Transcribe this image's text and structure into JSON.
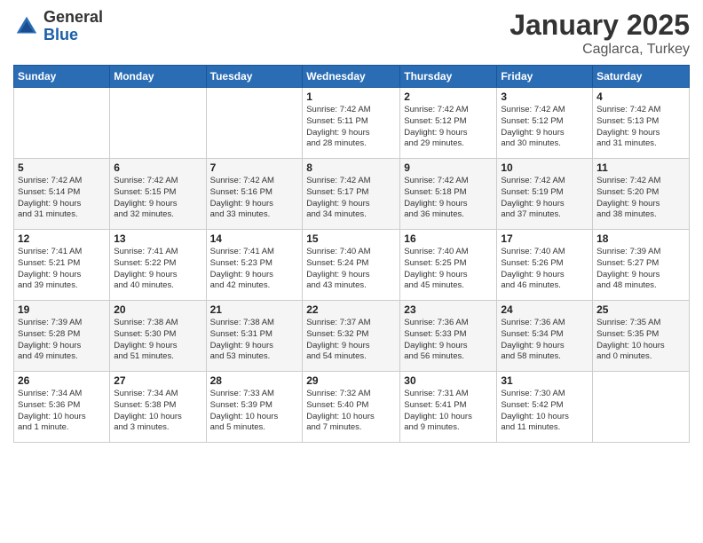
{
  "logo": {
    "general": "General",
    "blue": "Blue"
  },
  "header": {
    "month": "January 2025",
    "location": "Caglarca, Turkey"
  },
  "weekdays": [
    "Sunday",
    "Monday",
    "Tuesday",
    "Wednesday",
    "Thursday",
    "Friday",
    "Saturday"
  ],
  "weeks": [
    [
      {
        "day": "",
        "info": ""
      },
      {
        "day": "",
        "info": ""
      },
      {
        "day": "",
        "info": ""
      },
      {
        "day": "1",
        "info": "Sunrise: 7:42 AM\nSunset: 5:11 PM\nDaylight: 9 hours\nand 28 minutes."
      },
      {
        "day": "2",
        "info": "Sunrise: 7:42 AM\nSunset: 5:12 PM\nDaylight: 9 hours\nand 29 minutes."
      },
      {
        "day": "3",
        "info": "Sunrise: 7:42 AM\nSunset: 5:12 PM\nDaylight: 9 hours\nand 30 minutes."
      },
      {
        "day": "4",
        "info": "Sunrise: 7:42 AM\nSunset: 5:13 PM\nDaylight: 9 hours\nand 31 minutes."
      }
    ],
    [
      {
        "day": "5",
        "info": "Sunrise: 7:42 AM\nSunset: 5:14 PM\nDaylight: 9 hours\nand 31 minutes."
      },
      {
        "day": "6",
        "info": "Sunrise: 7:42 AM\nSunset: 5:15 PM\nDaylight: 9 hours\nand 32 minutes."
      },
      {
        "day": "7",
        "info": "Sunrise: 7:42 AM\nSunset: 5:16 PM\nDaylight: 9 hours\nand 33 minutes."
      },
      {
        "day": "8",
        "info": "Sunrise: 7:42 AM\nSunset: 5:17 PM\nDaylight: 9 hours\nand 34 minutes."
      },
      {
        "day": "9",
        "info": "Sunrise: 7:42 AM\nSunset: 5:18 PM\nDaylight: 9 hours\nand 36 minutes."
      },
      {
        "day": "10",
        "info": "Sunrise: 7:42 AM\nSunset: 5:19 PM\nDaylight: 9 hours\nand 37 minutes."
      },
      {
        "day": "11",
        "info": "Sunrise: 7:42 AM\nSunset: 5:20 PM\nDaylight: 9 hours\nand 38 minutes."
      }
    ],
    [
      {
        "day": "12",
        "info": "Sunrise: 7:41 AM\nSunset: 5:21 PM\nDaylight: 9 hours\nand 39 minutes."
      },
      {
        "day": "13",
        "info": "Sunrise: 7:41 AM\nSunset: 5:22 PM\nDaylight: 9 hours\nand 40 minutes."
      },
      {
        "day": "14",
        "info": "Sunrise: 7:41 AM\nSunset: 5:23 PM\nDaylight: 9 hours\nand 42 minutes."
      },
      {
        "day": "15",
        "info": "Sunrise: 7:40 AM\nSunset: 5:24 PM\nDaylight: 9 hours\nand 43 minutes."
      },
      {
        "day": "16",
        "info": "Sunrise: 7:40 AM\nSunset: 5:25 PM\nDaylight: 9 hours\nand 45 minutes."
      },
      {
        "day": "17",
        "info": "Sunrise: 7:40 AM\nSunset: 5:26 PM\nDaylight: 9 hours\nand 46 minutes."
      },
      {
        "day": "18",
        "info": "Sunrise: 7:39 AM\nSunset: 5:27 PM\nDaylight: 9 hours\nand 48 minutes."
      }
    ],
    [
      {
        "day": "19",
        "info": "Sunrise: 7:39 AM\nSunset: 5:28 PM\nDaylight: 9 hours\nand 49 minutes."
      },
      {
        "day": "20",
        "info": "Sunrise: 7:38 AM\nSunset: 5:30 PM\nDaylight: 9 hours\nand 51 minutes."
      },
      {
        "day": "21",
        "info": "Sunrise: 7:38 AM\nSunset: 5:31 PM\nDaylight: 9 hours\nand 53 minutes."
      },
      {
        "day": "22",
        "info": "Sunrise: 7:37 AM\nSunset: 5:32 PM\nDaylight: 9 hours\nand 54 minutes."
      },
      {
        "day": "23",
        "info": "Sunrise: 7:36 AM\nSunset: 5:33 PM\nDaylight: 9 hours\nand 56 minutes."
      },
      {
        "day": "24",
        "info": "Sunrise: 7:36 AM\nSunset: 5:34 PM\nDaylight: 9 hours\nand 58 minutes."
      },
      {
        "day": "25",
        "info": "Sunrise: 7:35 AM\nSunset: 5:35 PM\nDaylight: 10 hours\nand 0 minutes."
      }
    ],
    [
      {
        "day": "26",
        "info": "Sunrise: 7:34 AM\nSunset: 5:36 PM\nDaylight: 10 hours\nand 1 minute."
      },
      {
        "day": "27",
        "info": "Sunrise: 7:34 AM\nSunset: 5:38 PM\nDaylight: 10 hours\nand 3 minutes."
      },
      {
        "day": "28",
        "info": "Sunrise: 7:33 AM\nSunset: 5:39 PM\nDaylight: 10 hours\nand 5 minutes."
      },
      {
        "day": "29",
        "info": "Sunrise: 7:32 AM\nSunset: 5:40 PM\nDaylight: 10 hours\nand 7 minutes."
      },
      {
        "day": "30",
        "info": "Sunrise: 7:31 AM\nSunset: 5:41 PM\nDaylight: 10 hours\nand 9 minutes."
      },
      {
        "day": "31",
        "info": "Sunrise: 7:30 AM\nSunset: 5:42 PM\nDaylight: 10 hours\nand 11 minutes."
      },
      {
        "day": "",
        "info": ""
      }
    ]
  ]
}
